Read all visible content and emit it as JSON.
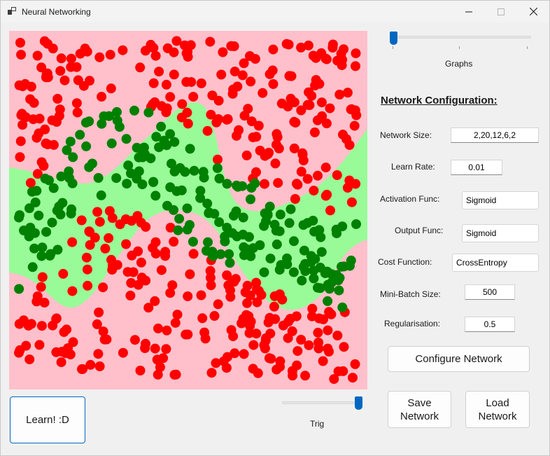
{
  "window": {
    "title": "Neural Networking",
    "icon": "app-window-icon",
    "controls": [
      "minimize-icon",
      "maximize-icon",
      "close-icon"
    ]
  },
  "plot": {
    "background_color": "#ffc0cb",
    "band_color": "#98fb98",
    "red_point_color": "#ff0000",
    "green_point_color": "#008000"
  },
  "graphs_slider": {
    "label": "Graphs",
    "value": 0
  },
  "trig_slider": {
    "label": "Trig",
    "value": 1
  },
  "learn_button": {
    "label": "Learn! :D"
  },
  "config": {
    "title": "Network Configuration:",
    "network_size": {
      "label": "Network Size:",
      "value": "2,20,12,6,2"
    },
    "learn_rate": {
      "label": "Learn Rate:",
      "value": "0.01"
    },
    "activation_func": {
      "label": "Activation Func:",
      "value": "Sigmoid"
    },
    "output_func": {
      "label": "Output Func:",
      "value": "Sigmoid"
    },
    "cost_function": {
      "label": "Cost Function:",
      "value": "CrossEntropy"
    },
    "mini_batch_size": {
      "label": "Mini-Batch Size:",
      "value": "500"
    },
    "regularisation": {
      "label": "Regularisation:",
      "value": "0.5"
    }
  },
  "buttons": {
    "configure": "Configure Network",
    "save_line1": "Save",
    "save_line2": "Network",
    "load_line1": "Load",
    "load_line2": "Network"
  },
  "accent_color": "#0067c0"
}
